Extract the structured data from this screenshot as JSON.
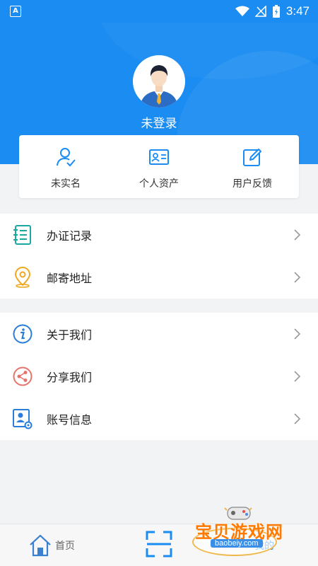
{
  "status_bar": {
    "left_glyph": "A",
    "time": "3:47"
  },
  "header": {
    "username": "未登录",
    "accent_color": "#1a8cf2"
  },
  "card": {
    "items": [
      {
        "label": "未实名",
        "icon": "user-check-icon"
      },
      {
        "label": "个人资产",
        "icon": "id-card-icon"
      },
      {
        "label": "用户反馈",
        "icon": "edit-icon"
      }
    ]
  },
  "menu_group1": [
    {
      "label": "办证记录",
      "icon": "notebook-icon"
    },
    {
      "label": "邮寄地址",
      "icon": "location-pin-icon"
    }
  ],
  "menu_group2": [
    {
      "label": "关于我们",
      "icon": "info-icon"
    },
    {
      "label": "分享我们",
      "icon": "share-icon"
    },
    {
      "label": "账号信息",
      "icon": "account-settings-icon"
    }
  ],
  "bottom_nav": {
    "home_label": "首页",
    "mine_label": "我的"
  },
  "watermark": {
    "title": "宝贝游戏网",
    "url": "baobeiy.com"
  }
}
